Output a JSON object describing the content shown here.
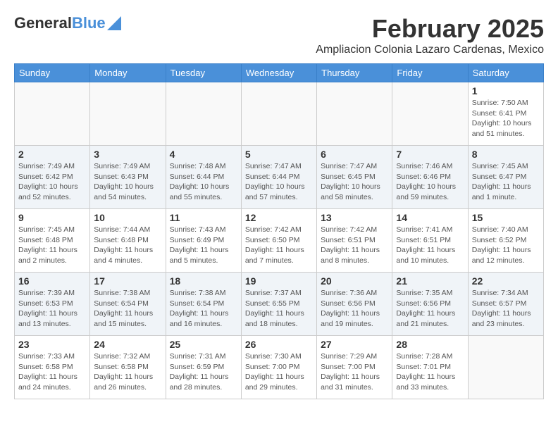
{
  "header": {
    "logo_general": "General",
    "logo_blue": "Blue",
    "month_title": "February 2025",
    "location": "Ampliacion Colonia Lazaro Cardenas, Mexico"
  },
  "weekdays": [
    "Sunday",
    "Monday",
    "Tuesday",
    "Wednesday",
    "Thursday",
    "Friday",
    "Saturday"
  ],
  "weeks": [
    [
      {
        "day": "",
        "info": ""
      },
      {
        "day": "",
        "info": ""
      },
      {
        "day": "",
        "info": ""
      },
      {
        "day": "",
        "info": ""
      },
      {
        "day": "",
        "info": ""
      },
      {
        "day": "",
        "info": ""
      },
      {
        "day": "1",
        "info": "Sunrise: 7:50 AM\nSunset: 6:41 PM\nDaylight: 10 hours\nand 51 minutes."
      }
    ],
    [
      {
        "day": "2",
        "info": "Sunrise: 7:49 AM\nSunset: 6:42 PM\nDaylight: 10 hours\nand 52 minutes."
      },
      {
        "day": "3",
        "info": "Sunrise: 7:49 AM\nSunset: 6:43 PM\nDaylight: 10 hours\nand 54 minutes."
      },
      {
        "day": "4",
        "info": "Sunrise: 7:48 AM\nSunset: 6:44 PM\nDaylight: 10 hours\nand 55 minutes."
      },
      {
        "day": "5",
        "info": "Sunrise: 7:47 AM\nSunset: 6:44 PM\nDaylight: 10 hours\nand 57 minutes."
      },
      {
        "day": "6",
        "info": "Sunrise: 7:47 AM\nSunset: 6:45 PM\nDaylight: 10 hours\nand 58 minutes."
      },
      {
        "day": "7",
        "info": "Sunrise: 7:46 AM\nSunset: 6:46 PM\nDaylight: 10 hours\nand 59 minutes."
      },
      {
        "day": "8",
        "info": "Sunrise: 7:45 AM\nSunset: 6:47 PM\nDaylight: 11 hours\nand 1 minute."
      }
    ],
    [
      {
        "day": "9",
        "info": "Sunrise: 7:45 AM\nSunset: 6:48 PM\nDaylight: 11 hours\nand 2 minutes."
      },
      {
        "day": "10",
        "info": "Sunrise: 7:44 AM\nSunset: 6:48 PM\nDaylight: 11 hours\nand 4 minutes."
      },
      {
        "day": "11",
        "info": "Sunrise: 7:43 AM\nSunset: 6:49 PM\nDaylight: 11 hours\nand 5 minutes."
      },
      {
        "day": "12",
        "info": "Sunrise: 7:42 AM\nSunset: 6:50 PM\nDaylight: 11 hours\nand 7 minutes."
      },
      {
        "day": "13",
        "info": "Sunrise: 7:42 AM\nSunset: 6:51 PM\nDaylight: 11 hours\nand 8 minutes."
      },
      {
        "day": "14",
        "info": "Sunrise: 7:41 AM\nSunset: 6:51 PM\nDaylight: 11 hours\nand 10 minutes."
      },
      {
        "day": "15",
        "info": "Sunrise: 7:40 AM\nSunset: 6:52 PM\nDaylight: 11 hours\nand 12 minutes."
      }
    ],
    [
      {
        "day": "16",
        "info": "Sunrise: 7:39 AM\nSunset: 6:53 PM\nDaylight: 11 hours\nand 13 minutes."
      },
      {
        "day": "17",
        "info": "Sunrise: 7:38 AM\nSunset: 6:54 PM\nDaylight: 11 hours\nand 15 minutes."
      },
      {
        "day": "18",
        "info": "Sunrise: 7:38 AM\nSunset: 6:54 PM\nDaylight: 11 hours\nand 16 minutes."
      },
      {
        "day": "19",
        "info": "Sunrise: 7:37 AM\nSunset: 6:55 PM\nDaylight: 11 hours\nand 18 minutes."
      },
      {
        "day": "20",
        "info": "Sunrise: 7:36 AM\nSunset: 6:56 PM\nDaylight: 11 hours\nand 19 minutes."
      },
      {
        "day": "21",
        "info": "Sunrise: 7:35 AM\nSunset: 6:56 PM\nDaylight: 11 hours\nand 21 minutes."
      },
      {
        "day": "22",
        "info": "Sunrise: 7:34 AM\nSunset: 6:57 PM\nDaylight: 11 hours\nand 23 minutes."
      }
    ],
    [
      {
        "day": "23",
        "info": "Sunrise: 7:33 AM\nSunset: 6:58 PM\nDaylight: 11 hours\nand 24 minutes."
      },
      {
        "day": "24",
        "info": "Sunrise: 7:32 AM\nSunset: 6:58 PM\nDaylight: 11 hours\nand 26 minutes."
      },
      {
        "day": "25",
        "info": "Sunrise: 7:31 AM\nSunset: 6:59 PM\nDaylight: 11 hours\nand 28 minutes."
      },
      {
        "day": "26",
        "info": "Sunrise: 7:30 AM\nSunset: 7:00 PM\nDaylight: 11 hours\nand 29 minutes."
      },
      {
        "day": "27",
        "info": "Sunrise: 7:29 AM\nSunset: 7:00 PM\nDaylight: 11 hours\nand 31 minutes."
      },
      {
        "day": "28",
        "info": "Sunrise: 7:28 AM\nSunset: 7:01 PM\nDaylight: 11 hours\nand 33 minutes."
      },
      {
        "day": "",
        "info": ""
      }
    ]
  ]
}
